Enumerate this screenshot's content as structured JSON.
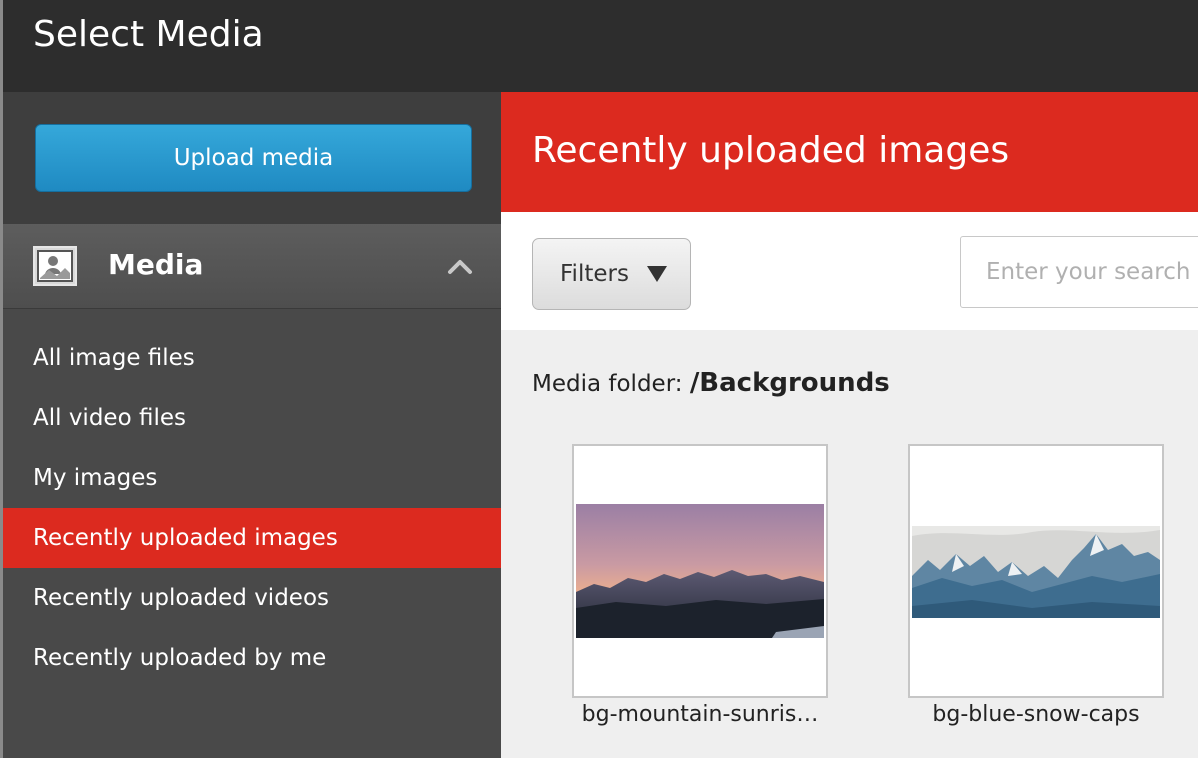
{
  "window": {
    "title": "Select Media"
  },
  "sidebar": {
    "upload_label": "Upload media",
    "section_label": "Media",
    "section_icon": "image-icon",
    "items": [
      {
        "label": "All image files",
        "active": false
      },
      {
        "label": "All video files",
        "active": false
      },
      {
        "label": "My images",
        "active": false
      },
      {
        "label": "Recently uploaded images",
        "active": true
      },
      {
        "label": "Recently uploaded videos",
        "active": false
      },
      {
        "label": "Recently uploaded by me",
        "active": false
      }
    ]
  },
  "main": {
    "heading": "Recently uploaded images",
    "filters_label": "Filters",
    "search_placeholder": "Enter your search criteria",
    "folder_label": "Media folder:",
    "folder_path": "/Backgrounds",
    "items": [
      {
        "caption": "bg-mountain-sunris…"
      },
      {
        "caption": "bg-blue-snow-caps"
      }
    ]
  },
  "colors": {
    "accent": "#dc2a1f",
    "primary_button": "#2596cf",
    "titlebar": "#2d2d2d",
    "sidebar": "#494949"
  }
}
